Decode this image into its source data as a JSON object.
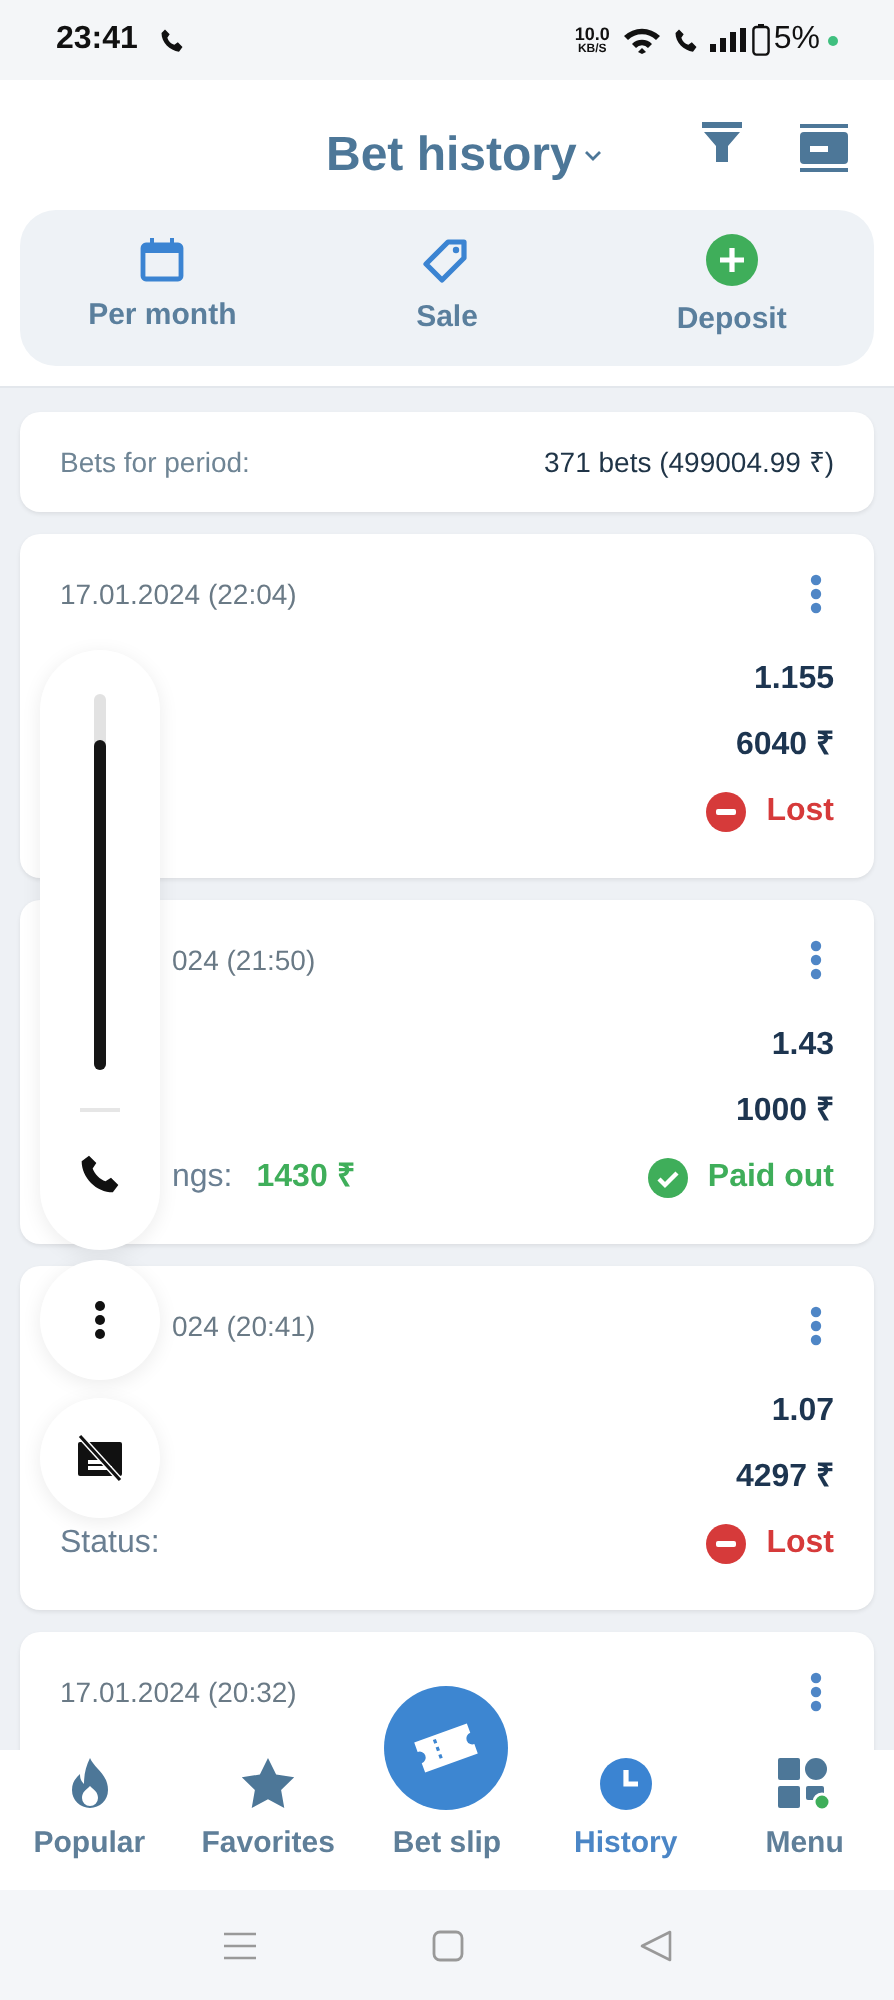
{
  "status_bar": {
    "time": "23:41",
    "net_speed": "10.0",
    "net_unit": "KB/S",
    "battery": "5%"
  },
  "header": {
    "title": "Bet history"
  },
  "actions": [
    {
      "kind": "calendar",
      "label": "Per month"
    },
    {
      "kind": "tag",
      "label": "Sale"
    },
    {
      "kind": "deposit",
      "label": "Deposit"
    }
  ],
  "summary": {
    "label": "Bets for period:",
    "value": "371 bets (499004.99 ₹)"
  },
  "bets": [
    {
      "date": "17.01.2024 (22:04)",
      "rows": [
        {
          "kind": "plain",
          "value": "1.155"
        },
        {
          "kind": "plain",
          "value": "6040 ₹"
        },
        {
          "kind": "lost",
          "value": "Lost"
        }
      ]
    },
    {
      "date": "024 (21:50)",
      "date_cut": true,
      "rows": [
        {
          "kind": "plain",
          "value": "1.43"
        },
        {
          "kind": "plain",
          "value": "1000 ₹"
        },
        {
          "kind": "paid_out",
          "label": "ngs:",
          "label_cut": true,
          "amount": "1430 ₹",
          "value": "Paid out"
        }
      ]
    },
    {
      "date": "024 (20:41)",
      "date_cut": true,
      "rows": [
        {
          "kind": "plain",
          "value": "1.07"
        },
        {
          "kind": "plain",
          "value": "4297 ₹"
        },
        {
          "kind": "lost",
          "label": "Status:",
          "label_cut": false,
          "value": "Lost"
        }
      ]
    },
    {
      "date": "17.01.2024 (20:32)",
      "date_cut": false
    }
  ],
  "overlay": {
    "volume": {
      "level": 0.88
    }
  },
  "nav": [
    {
      "kind": "flame",
      "label": "Popular",
      "selected": false
    },
    {
      "kind": "star",
      "label": "Favorites",
      "selected": false
    },
    {
      "kind": "ticket",
      "label": "Bet slip",
      "selected": false
    },
    {
      "kind": "clock",
      "label": "History",
      "selected": true
    },
    {
      "kind": "grid",
      "label": "Menu",
      "selected": false
    }
  ]
}
